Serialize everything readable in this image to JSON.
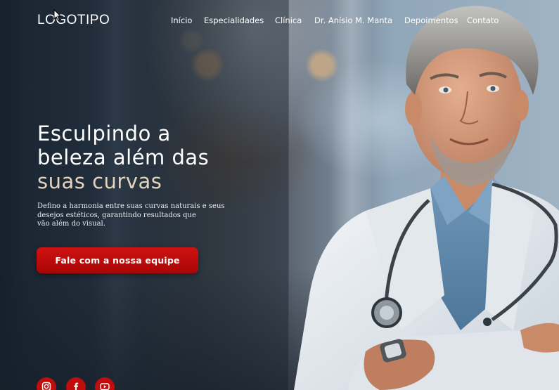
{
  "header": {
    "logo": "LOGOTIPO",
    "nav": [
      {
        "label": "Início"
      },
      {
        "label": "Especialidades"
      },
      {
        "label": "Clínica"
      },
      {
        "label": "Dr. Anísio M. Manta"
      },
      {
        "label": "Depoimentos"
      },
      {
        "label": "Contato"
      }
    ]
  },
  "hero": {
    "headline": [
      "Esculpindo a",
      "beleza além das",
      "suas curvas"
    ],
    "description": [
      "Defino a harmonia entre suas curvas naturais e seus",
      "desejos estéticos, garantindo resultados que",
      "vão além do visual."
    ],
    "cta_label": "Fale com a nossa equipe"
  },
  "social": [
    {
      "icon": "instagram-icon"
    },
    {
      "icon": "facebook-icon"
    },
    {
      "icon": "youtube-icon"
    }
  ],
  "colors": {
    "accent": "#c20d0d",
    "headline_accent": "#e3d3bd",
    "overlay": "#16202c"
  }
}
